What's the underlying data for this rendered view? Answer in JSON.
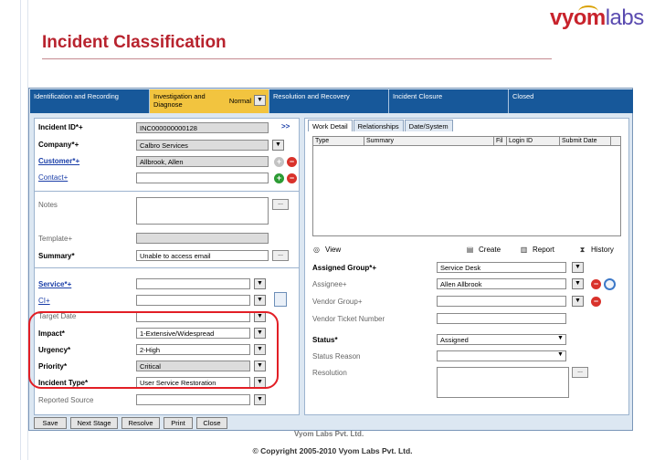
{
  "slide": {
    "title": "Incident Classification",
    "logo_part1": "vyom",
    "logo_part2": "labs",
    "footer_ghost": "Vyom Labs Pvt. Ltd.",
    "copyright": "© Copyright 2005-2010 Vyom Labs Pvt. Ltd."
  },
  "stages": [
    {
      "label": "Identification and Recording"
    },
    {
      "label": "Investigation and Diagnose",
      "value": "Normal"
    },
    {
      "label": "Resolution and Recovery"
    },
    {
      "label": "Incident Closure"
    },
    {
      "label": "Closed"
    }
  ],
  "left": {
    "incident_id": {
      "label": "Incident ID*+",
      "value": "INC000000000128",
      "more": ">>"
    },
    "company": {
      "label": "Company*+",
      "value": "Calbro Services"
    },
    "customer": {
      "label": "Customer*+",
      "value": "Allbrook, Allen"
    },
    "contact": {
      "label": "Contact+",
      "value": ""
    },
    "notes": {
      "label": "Notes",
      "btn": "..."
    },
    "template": {
      "label": "Template+",
      "value": ""
    },
    "summary": {
      "label": "Summary*",
      "value": "Unable to access email",
      "btn": "..."
    },
    "service": {
      "label": "Service*+",
      "value": ""
    },
    "ci": {
      "label": "CI+",
      "value": ""
    },
    "target_date": {
      "label": "Target Date",
      "value": ""
    },
    "impact": {
      "label": "Impact*",
      "value": "1-Extensive/Widespread"
    },
    "urgency": {
      "label": "Urgency*",
      "value": "2-High"
    },
    "priority": {
      "label": "Priority*",
      "value": "Critical"
    },
    "incident_type": {
      "label": "Incident Type*",
      "value": "User Service Restoration"
    },
    "reported_source": {
      "label": "Reported Source",
      "value": ""
    }
  },
  "right": {
    "tabs": [
      "Work Detail",
      "Relationships",
      "Date/System"
    ],
    "columns": [
      "Type",
      "Summary",
      "Fil",
      "Login ID",
      "Submit Date"
    ],
    "actions": {
      "view": "View",
      "create": "Create",
      "report": "Report",
      "history": "History"
    },
    "assigned_group": {
      "label": "Assigned Group*+",
      "value": "Service Desk"
    },
    "assignee": {
      "label": "Assignee+",
      "value": "Allen Allbrook"
    },
    "vendor_group": {
      "label": "Vendor Group+",
      "value": ""
    },
    "vendor_ticket": {
      "label": "Vendor Ticket Number",
      "value": ""
    },
    "status": {
      "label": "Status*",
      "value": "Assigned"
    },
    "status_reason": {
      "label": "Status Reason",
      "value": ""
    },
    "resolution": {
      "label": "Resolution",
      "btn": "..."
    }
  },
  "buttons": [
    "Save",
    "Next Stage",
    "Resolve",
    "Print",
    "Close"
  ],
  "colors": {
    "title": "#b8232e",
    "stage_bar": "#17589a",
    "active_stage": "#f2c43f",
    "highlight": "#e21e25"
  },
  "icons": [
    "dropdown-arrow-icon",
    "remove-icon",
    "add-icon",
    "view-icon",
    "create-icon",
    "report-icon",
    "history-icon",
    "clock-icon",
    "document-icon"
  ]
}
